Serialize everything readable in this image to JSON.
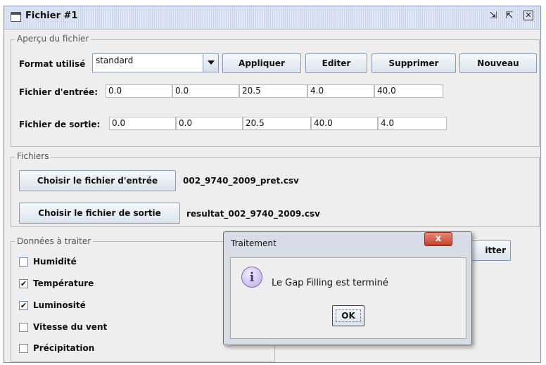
{
  "window": {
    "title": "Fichier #1"
  },
  "apercu": {
    "legend": "Aperçu du fichier",
    "format_label": "Format utilisé",
    "format_value": "standard",
    "buttons": [
      "Appliquer",
      "Editer",
      "Supprimer",
      "Nouveau"
    ],
    "input_label": "Fichier d'entrée:",
    "input_values": [
      "0.0",
      "0.0",
      "20.5",
      "4.0",
      "40.0"
    ],
    "output_label": "Fichier de sortie:",
    "output_values": [
      "0.0",
      "0.0",
      "20.5",
      "40.0",
      "4.0"
    ]
  },
  "fichiers": {
    "legend": "Fichiers",
    "choose_input": "Choisir le fichier d'entrée",
    "input_file": "002_9740_2009_pret.csv",
    "choose_output": "Choisir le fichier de sortie",
    "output_file": "resultat_002_9740_2009.csv"
  },
  "donnees": {
    "legend": "Données à traiter",
    "items": [
      {
        "label": "Humidité",
        "mark": ""
      },
      {
        "label": "Température",
        "mark": "✔"
      },
      {
        "label": "Luminosité",
        "mark": "✔"
      },
      {
        "label": "Vitesse du vent",
        "mark": ""
      },
      {
        "label": "Précipitation",
        "mark": ""
      }
    ]
  },
  "background_button_fragment": "itter",
  "dialog": {
    "title": "Traitement",
    "close_glyph": "x",
    "icon_glyph": "i",
    "message": "Le Gap Filling est terminé",
    "ok": "OK"
  },
  "icons": {
    "title": "window-icon",
    "minimize": "restore-down-icon",
    "maximize": "maximize-icon",
    "close": "close-icon"
  }
}
